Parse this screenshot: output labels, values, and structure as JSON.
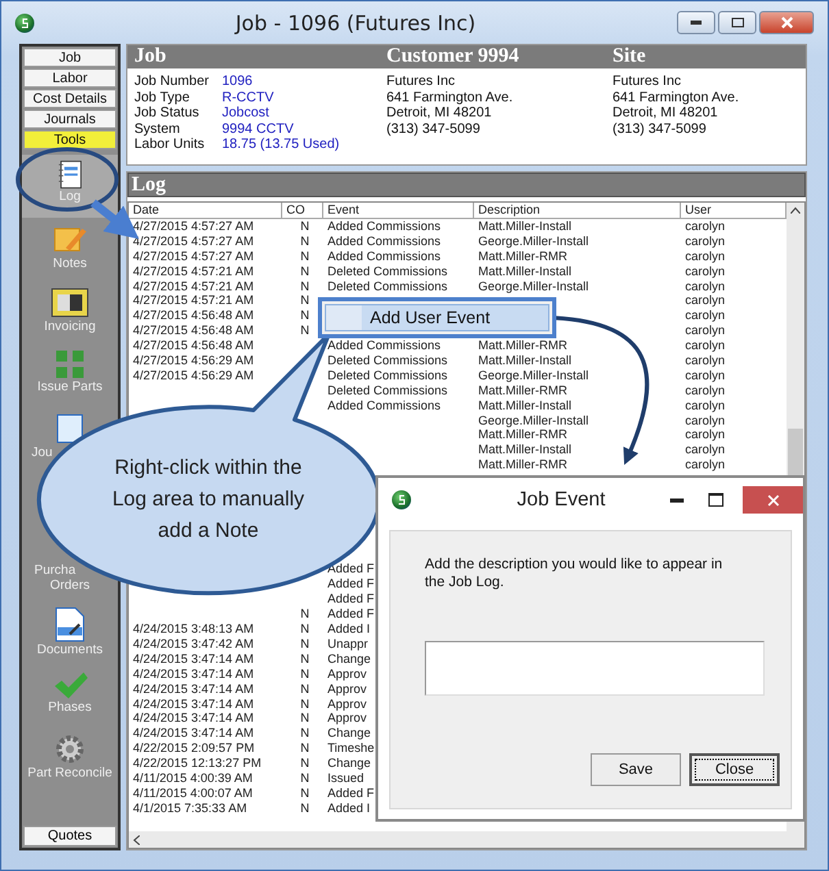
{
  "window": {
    "title": "Job - 1096 (Futures  Inc)"
  },
  "tabs": [
    {
      "label": "Job",
      "selected": false
    },
    {
      "label": "Labor",
      "selected": false
    },
    {
      "label": "Cost Details",
      "selected": false
    },
    {
      "label": "Journals",
      "selected": false
    },
    {
      "label": "Tools",
      "selected": true
    }
  ],
  "tools": [
    {
      "kind": "log",
      "lines": [
        "Log"
      ],
      "selected": true
    },
    {
      "kind": "notes",
      "lines": [
        "Notes"
      ],
      "selected": false
    },
    {
      "kind": "invoicing",
      "lines": [
        "Invoicing"
      ],
      "selected": false
    },
    {
      "kind": "parts",
      "lines": [
        "Issue Parts"
      ],
      "selected": false
    },
    {
      "kind": "journals",
      "lines": [
        "Jou"
      ],
      "selected": false
    },
    {
      "kind": "orders",
      "lines": [
        "Purcha",
        "Orders"
      ],
      "selected": false
    },
    {
      "kind": "documents",
      "lines": [
        "Documents"
      ],
      "selected": false
    },
    {
      "kind": "phases",
      "lines": [
        "Phases"
      ],
      "selected": false
    },
    {
      "kind": "reconcile",
      "lines": [
        "Part Reconcile"
      ],
      "selected": false
    }
  ],
  "bottom_tab": {
    "label": "Quotes"
  },
  "header": {
    "columns": [
      "Job",
      "Customer 9994",
      "Site"
    ],
    "job_fields": [
      {
        "label": "Job Number",
        "value": "1096"
      },
      {
        "label": "Job Type",
        "value": "R-CCTV"
      },
      {
        "label": "Job Status",
        "value": "Jobcost"
      },
      {
        "label": "System",
        "value": "9994 CCTV"
      },
      {
        "label": "Labor Units",
        "value": "18.75 (13.75 Used)"
      }
    ],
    "customer": [
      "Futures  Inc",
      "641 Farmington Ave.",
      "Detroit, MI  48201",
      "(313) 347-5099"
    ],
    "site": [
      "Futures  Inc",
      "641 Farmington Ave.",
      "Detroit, MI  48201",
      "(313) 347-5099"
    ]
  },
  "log": {
    "title": "Log",
    "columns": [
      "Date",
      "CO",
      "Event",
      "Description",
      "User"
    ],
    "rows": [
      {
        "date": "4/27/2015 4:57:27 AM",
        "co": "N",
        "event": "Added Commissions",
        "description": "Matt.Miller-Install",
        "user": "carolyn"
      },
      {
        "date": "4/27/2015 4:57:27 AM",
        "co": "N",
        "event": "Added Commissions",
        "description": "George.Miller-Install",
        "user": "carolyn"
      },
      {
        "date": "4/27/2015 4:57:27 AM",
        "co": "N",
        "event": "Added Commissions",
        "description": "Matt.Miller-RMR",
        "user": "carolyn"
      },
      {
        "date": "4/27/2015 4:57:21 AM",
        "co": "N",
        "event": "Deleted Commissions",
        "description": "Matt.Miller-Install",
        "user": "carolyn"
      },
      {
        "date": "4/27/2015 4:57:21 AM",
        "co": "N",
        "event": "Deleted Commissions",
        "description": "George.Miller-Install",
        "user": "carolyn"
      },
      {
        "date": "4/27/2015 4:57:21 AM",
        "co": "N",
        "user": "carolyn"
      },
      {
        "date": "4/27/2015 4:56:48 AM",
        "co": "N",
        "user": "carolyn"
      },
      {
        "date": "4/27/2015 4:56:48 AM",
        "co": "N",
        "user": "carolyn"
      },
      {
        "date": "4/27/2015 4:56:48 AM",
        "event": "Added Commissions",
        "description": "Matt.Miller-RMR",
        "user": "carolyn"
      },
      {
        "date": "4/27/2015 4:56:29 AM",
        "event": "Deleted Commissions",
        "description": "Matt.Miller-Install",
        "user": "carolyn"
      },
      {
        "date": "4/27/2015 4:56:29 AM",
        "event": "Deleted Commissions",
        "description": "George.Miller-Install",
        "user": "carolyn"
      },
      {
        "event": "Deleted Commissions",
        "description": "Matt.Miller-RMR",
        "user": "carolyn"
      },
      {
        "event": "Added Commissions",
        "description": "Matt.Miller-Install",
        "user": "carolyn"
      },
      {
        "description": "George.Miller-Install",
        "user": "carolyn"
      },
      {
        "description": "Matt.Miller-RMR",
        "user": "carolyn"
      },
      {
        "description": "Matt.Miller-Install",
        "user": "carolyn"
      },
      {
        "description": "Matt.Miller-RMR",
        "user": "carolyn"
      },
      {},
      {},
      {},
      {},
      {},
      {},
      {
        "event": "Added F"
      },
      {
        "event": "Added F"
      },
      {
        "event": "Added F"
      },
      {
        "co": "N",
        "event": "Added F"
      },
      {
        "date": "4/24/2015 3:48:13 AM",
        "co": "N",
        "event": "Added I"
      },
      {
        "date": "4/24/2015 3:47:42 AM",
        "co": "N",
        "event": "Unappr"
      },
      {
        "date": "4/24/2015 3:47:14 AM",
        "co": "N",
        "event": "Change"
      },
      {
        "date": "4/24/2015 3:47:14 AM",
        "co": "N",
        "event": "Approv"
      },
      {
        "date": "4/24/2015 3:47:14 AM",
        "co": "N",
        "event": "Approv"
      },
      {
        "date": "4/24/2015 3:47:14 AM",
        "co": "N",
        "event": "Approv"
      },
      {
        "date": "4/24/2015 3:47:14 AM",
        "co": "N",
        "event": "Approv"
      },
      {
        "date": "4/24/2015 3:47:14 AM",
        "co": "N",
        "event": "Change"
      },
      {
        "date": "4/22/2015 2:09:57 PM",
        "co": "N",
        "event": "Timeshe"
      },
      {
        "date": "4/22/2015 12:13:27 PM",
        "co": "N",
        "event": "Change"
      },
      {
        "date": "4/11/2015 4:00:39 AM",
        "co": "N",
        "event": "Issued"
      },
      {
        "date": "4/11/2015 4:00:07 AM",
        "co": "N",
        "event": "Added F"
      },
      {
        "date": "4/1/2015 7:35:33 AM",
        "co": "N",
        "event": "Added I"
      }
    ]
  },
  "context_menu": {
    "items": [
      "Add User Event"
    ]
  },
  "callout": {
    "text": "Right-click within the Log area to manually add a Note"
  },
  "dialog": {
    "title": "Job Event",
    "prompt": "Add the description you would like to appear in the Job Log.",
    "buttons": [
      {
        "label": "Save",
        "focused": false
      },
      {
        "label": "Close",
        "focused": true
      }
    ]
  }
}
